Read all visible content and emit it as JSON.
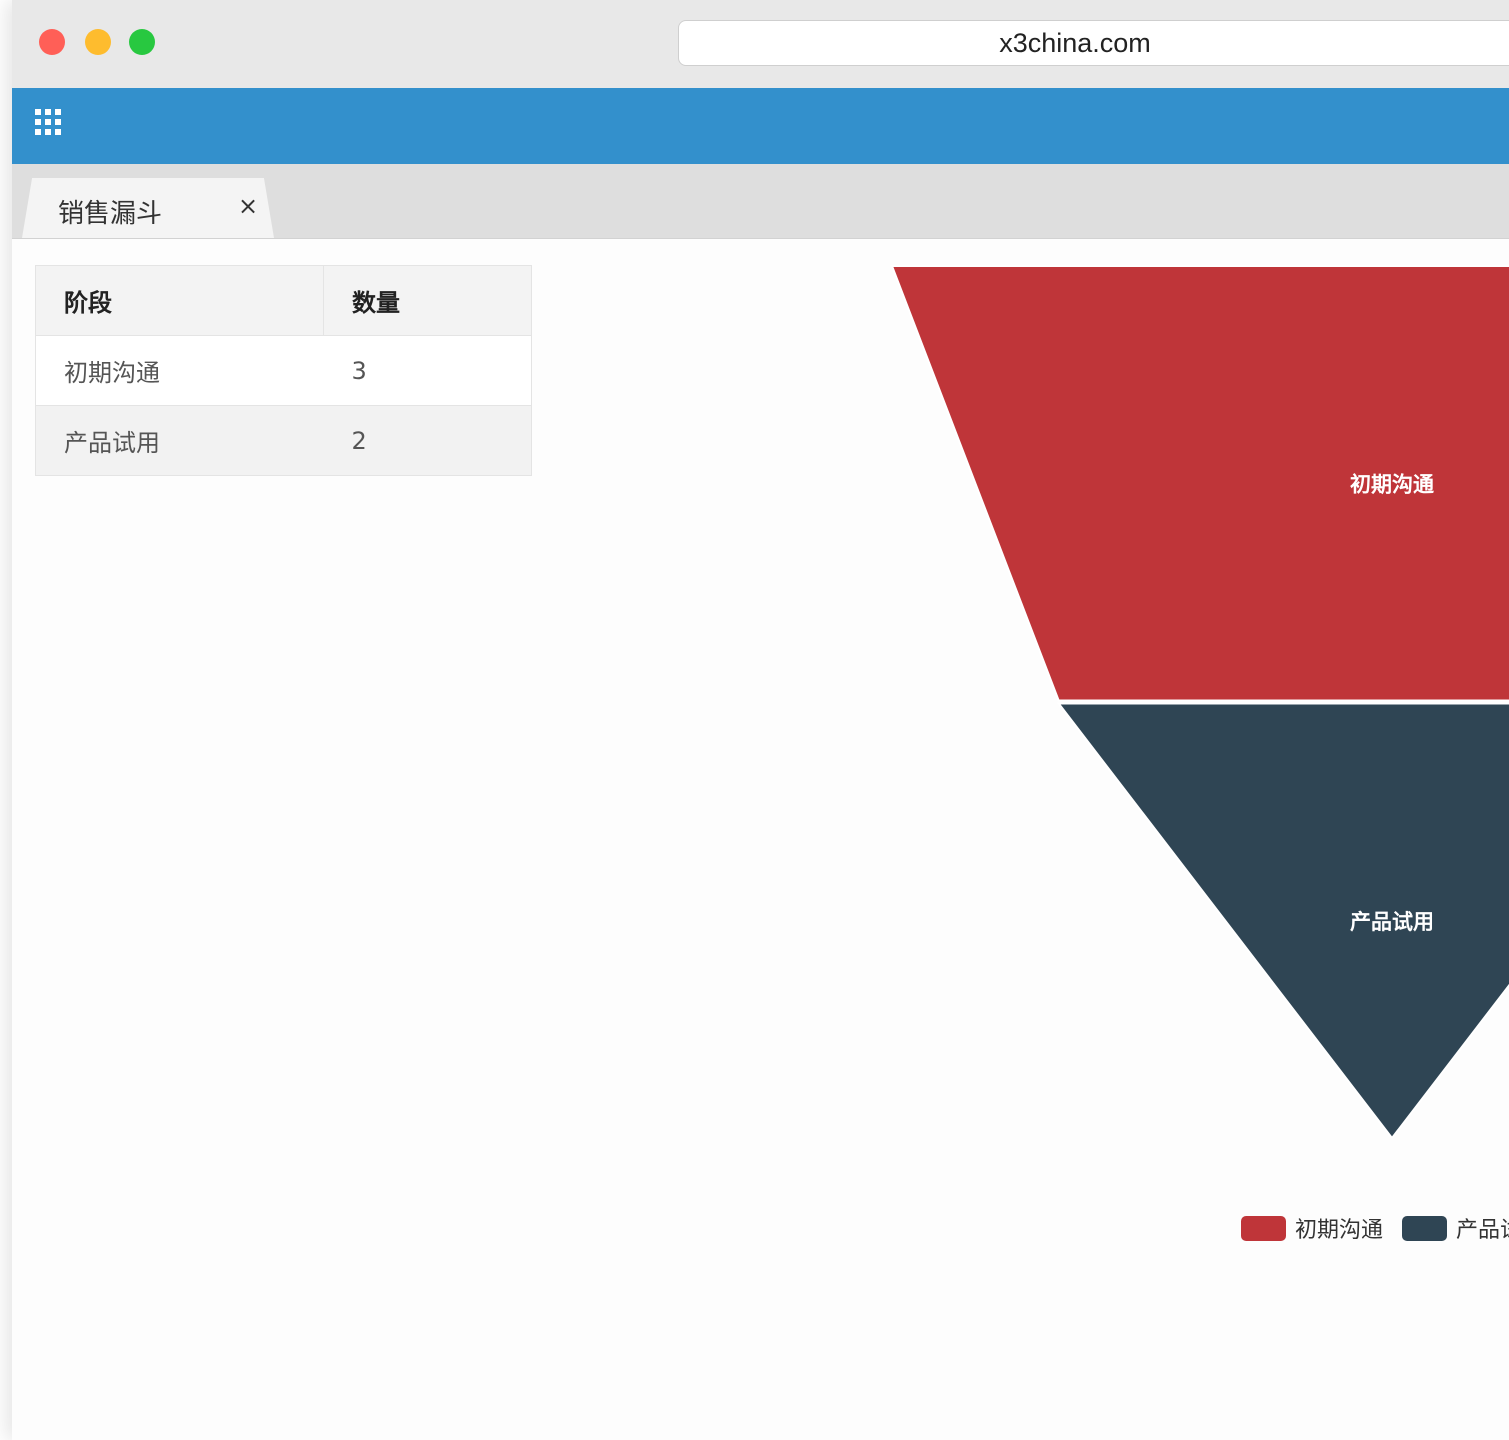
{
  "browser": {
    "url": "x3china.com",
    "traffic_lights": {
      "close": "#ff5f57",
      "minimize": "#febc2e",
      "maximize": "#28c840"
    }
  },
  "header": {
    "menu_icon": "grid-apps-icon",
    "color": "#3390cc"
  },
  "tabs": [
    {
      "label": "销售漏斗",
      "close_label": "×",
      "active": true
    }
  ],
  "table": {
    "columns": [
      "阶段",
      "数量"
    ],
    "rows": [
      {
        "stage": "初期沟通",
        "count": "3"
      },
      {
        "stage": "产品试用",
        "count": "2"
      }
    ]
  },
  "chart_data": {
    "type": "funnel",
    "title": "",
    "series": [
      {
        "name": "初期沟通",
        "value": 3,
        "color": "#bf3539"
      },
      {
        "name": "产品试用",
        "value": 2,
        "color": "#2f4554"
      }
    ],
    "legend": {
      "placement": "bottom-right",
      "entries": [
        "初期沟通",
        "产品试用"
      ]
    }
  }
}
